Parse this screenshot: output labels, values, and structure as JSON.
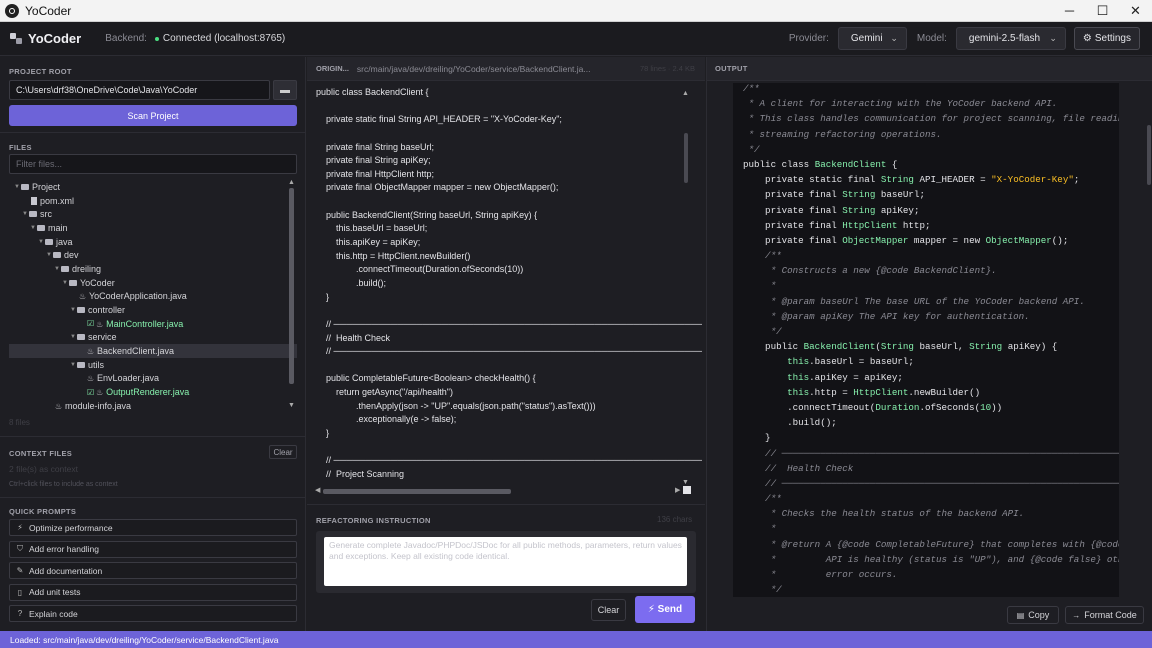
{
  "window": {
    "title": "YoCoder",
    "minimize": "─",
    "maximize": "☐",
    "close": "✕"
  },
  "header": {
    "brand": "YoCoder",
    "backend_label": "Backend:",
    "backend_status": "Connected (localhost:8765)",
    "status_color": "#4ade80",
    "provider_label": "Provider:",
    "provider_value": "Gemini",
    "model_label": "Model:",
    "model_value": "gemini-2.5-flash",
    "settings_label": "Settings"
  },
  "project": {
    "section_title": "PROJECT ROOT",
    "root_path": "C:\\Users\\drf38\\OneDrive\\Code\\Java\\YoCoder",
    "scan_label": "Scan Project"
  },
  "files": {
    "section_title": "FILES",
    "filter_placeholder": "Filter files...",
    "count": "8 files",
    "tree": [
      {
        "label": "Project",
        "depth": 1,
        "kind": "folder",
        "arrow": "▼"
      },
      {
        "label": "pom.xml",
        "depth": 3,
        "kind": "file"
      },
      {
        "label": "src",
        "depth": 2,
        "kind": "folder",
        "arrow": "▼"
      },
      {
        "label": "main",
        "depth": 3,
        "kind": "folder",
        "arrow": "▼"
      },
      {
        "label": "java",
        "depth": 4,
        "kind": "folder",
        "arrow": "▼"
      },
      {
        "label": "dev",
        "depth": 5,
        "kind": "folder",
        "arrow": "▼"
      },
      {
        "label": "dreiling",
        "depth": 6,
        "kind": "folder",
        "arrow": "▼"
      },
      {
        "label": "YoCoder",
        "depth": 7,
        "kind": "folder",
        "arrow": "▼"
      },
      {
        "label": "YoCoderApplication.java",
        "depth": 9,
        "kind": "java"
      },
      {
        "label": "controller",
        "depth": 8,
        "kind": "folder",
        "arrow": "▼"
      },
      {
        "label": "MainController.java",
        "depth": 10,
        "kind": "java",
        "checked": true
      },
      {
        "label": "service",
        "depth": 8,
        "kind": "folder",
        "arrow": "▼"
      },
      {
        "label": "BackendClient.java",
        "depth": 10,
        "kind": "java",
        "selected": true
      },
      {
        "label": "utils",
        "depth": 8,
        "kind": "folder",
        "arrow": "▼"
      },
      {
        "label": "EnvLoader.java",
        "depth": 10,
        "kind": "java"
      },
      {
        "label": "OutputRenderer.java",
        "depth": 10,
        "kind": "java",
        "checked": true
      },
      {
        "label": "module-info.java",
        "depth": 6,
        "kind": "java"
      }
    ]
  },
  "context": {
    "section_title": "CONTEXT FILES",
    "clear_label": "Clear",
    "count": "2 file(s) as context",
    "hint": "Ctrl+click files to include as context"
  },
  "quick_prompts": {
    "section_title": "QUICK PROMPTS",
    "items": [
      {
        "icon": "⚡",
        "label": "Optimize performance"
      },
      {
        "icon": "⛉",
        "label": "Add error handling"
      },
      {
        "icon": "✎",
        "label": "Add documentation"
      },
      {
        "icon": "▯",
        "label": "Add unit tests"
      },
      {
        "icon": "?",
        "label": "Explain code"
      }
    ]
  },
  "original": {
    "tab_label": "ORIGIN...",
    "path": "src/main/java/dev/dreiling/YoCoder/service/BackendClient.ja...",
    "meta": "78 lines · 2.4 KB",
    "lines": [
      "public class BackendClient {",
      "",
      "    private static final String API_HEADER = \"X-YoCoder-Key\";",
      "",
      "    private final String baseUrl;",
      "    private final String apiKey;",
      "    private final HttpClient http;",
      "    private final ObjectMapper mapper = new ObjectMapper();",
      "",
      "    public BackendClient(String baseUrl, String apiKey) {",
      "        this.baseUrl = baseUrl;",
      "        this.apiKey = apiKey;",
      "        this.http = HttpClient.newBuilder()",
      "                .connectTimeout(Duration.ofSeconds(10))",
      "                .build();",
      "    }",
      "",
      "    // ──────────────────────────────────────────────────────────────",
      "    //  Health Check",
      "    // ──────────────────────────────────────────────────────────────",
      "",
      "    public CompletableFuture<Boolean> checkHealth() {",
      "        return getAsync(\"/api/health\")",
      "                .thenApply(json -> \"UP\".equals(json.path(\"status\").asText()))",
      "                .exceptionally(e -> false);",
      "    }",
      "",
      "    // ──────────────────────────────────────────────────────────────",
      "    //  Project Scanning"
    ]
  },
  "refactor": {
    "section_title": "REFACTORING INSTRUCTION",
    "char_count": "136 chars",
    "instruction": "Generate complete Javadoc/PHPDoc/JSDoc for all public methods, parameters, return values and exceptions. Keep all existing code identical.",
    "clear_label": "Clear",
    "send_label": "⚡ Send"
  },
  "output": {
    "section_title": "OUTPUT",
    "copy_label": "Copy",
    "format_label": "Format Code",
    "lines": [
      [
        {
          "t": "cm",
          "v": "/**"
        }
      ],
      [
        {
          "t": "cm",
          "v": " * A client for interacting with the YoCoder backend API."
        }
      ],
      [
        {
          "t": "cm",
          "v": " * This class handles communication for project scanning, file reading, and"
        }
      ],
      [
        {
          "t": "cm",
          "v": " * streaming refactoring operations."
        }
      ],
      [
        {
          "t": "cm",
          "v": " */"
        }
      ],
      [
        {
          "t": "kw",
          "v": "public class "
        },
        {
          "t": "ty",
          "v": "BackendClient"
        },
        {
          "t": "kw",
          "v": " {"
        }
      ],
      [
        {
          "t": "kw",
          "v": "    private static final "
        },
        {
          "t": "ty",
          "v": "String"
        },
        {
          "t": "kw",
          "v": " API_HEADER = "
        },
        {
          "t": "st",
          "v": "\"X-YoCoder-Key\""
        },
        {
          "t": "kw",
          "v": ";"
        }
      ],
      [
        {
          "t": "kw",
          "v": "    private final "
        },
        {
          "t": "ty",
          "v": "String"
        },
        {
          "t": "kw",
          "v": " baseUrl;"
        }
      ],
      [
        {
          "t": "kw",
          "v": "    private final "
        },
        {
          "t": "ty",
          "v": "String"
        },
        {
          "t": "kw",
          "v": " apiKey;"
        }
      ],
      [
        {
          "t": "kw",
          "v": "    private final "
        },
        {
          "t": "ty",
          "v": "HttpClient"
        },
        {
          "t": "kw",
          "v": " http;"
        }
      ],
      [
        {
          "t": "kw",
          "v": "    private final "
        },
        {
          "t": "ty",
          "v": "ObjectMapper"
        },
        {
          "t": "kw",
          "v": " mapper = new "
        },
        {
          "t": "ty",
          "v": "ObjectMapper"
        },
        {
          "t": "kw",
          "v": "();"
        }
      ],
      [
        {
          "t": "cm",
          "v": "    /**"
        }
      ],
      [
        {
          "t": "cm",
          "v": "     * Constructs a new {@code BackendClient}."
        }
      ],
      [
        {
          "t": "cm",
          "v": "     *"
        }
      ],
      [
        {
          "t": "cm",
          "v": "     * @param baseUrl The base URL of the YoCoder backend API."
        }
      ],
      [
        {
          "t": "cm",
          "v": "     * @param apiKey The API key for authentication."
        }
      ],
      [
        {
          "t": "cm",
          "v": "     */"
        }
      ],
      [
        {
          "t": "kw",
          "v": "    public "
        },
        {
          "t": "ty",
          "v": "BackendClient"
        },
        {
          "t": "kw",
          "v": "("
        },
        {
          "t": "ty",
          "v": "String"
        },
        {
          "t": "kw",
          "v": " baseUrl, "
        },
        {
          "t": "ty",
          "v": "String"
        },
        {
          "t": "kw",
          "v": " apiKey) {"
        }
      ],
      [
        {
          "t": "ty",
          "v": "        this"
        },
        {
          "t": "kw",
          "v": ".baseUrl = baseUrl;"
        }
      ],
      [
        {
          "t": "ty",
          "v": "        this"
        },
        {
          "t": "kw",
          "v": ".apiKey = apiKey;"
        }
      ],
      [
        {
          "t": "ty",
          "v": "        this"
        },
        {
          "t": "kw",
          "v": ".http = "
        },
        {
          "t": "ty",
          "v": "HttpClient"
        },
        {
          "t": "kw",
          "v": ".newBuilder()"
        }
      ],
      [
        {
          "t": "kw",
          "v": "        .connectTimeout("
        },
        {
          "t": "ty",
          "v": "Duration"
        },
        {
          "t": "kw",
          "v": ".ofSeconds("
        },
        {
          "t": "ty",
          "v": "10"
        },
        {
          "t": "kw",
          "v": "))"
        }
      ],
      [
        {
          "t": "kw",
          "v": "        .build();"
        }
      ],
      [
        {
          "t": "kw",
          "v": "    }"
        }
      ],
      [
        {
          "t": "cm",
          "v": "    // ──────────────────────────────────────────────────────────────────"
        }
      ],
      [
        {
          "t": "cm",
          "v": "    //  Health Check"
        }
      ],
      [
        {
          "t": "cm",
          "v": "    // ──────────────────────────────────────────────────────────────────"
        }
      ],
      [
        {
          "t": "cm",
          "v": "    /**"
        }
      ],
      [
        {
          "t": "cm",
          "v": "     * Checks the health status of the backend API."
        }
      ],
      [
        {
          "t": "cm",
          "v": "     *"
        }
      ],
      [
        {
          "t": "cm",
          "v": "     * @return A {@code CompletableFuture} that completes with {@code true} if"
        }
      ],
      [
        {
          "t": "cm",
          "v": "     *         API is healthy (status is \"UP\"), and {@code false} otherwise or"
        }
      ],
      [
        {
          "t": "cm",
          "v": "     *         error occurs."
        }
      ],
      [
        {
          "t": "cm",
          "v": "     */"
        }
      ]
    ]
  },
  "status": {
    "text": "Loaded: src/main/java/dev/dreiling/YoCoder/service/BackendClient.java"
  },
  "colors": {
    "accent": "#6d63d8",
    "send": "#7c6cf0",
    "connected": "#4ade80",
    "checked": "#86efac"
  }
}
